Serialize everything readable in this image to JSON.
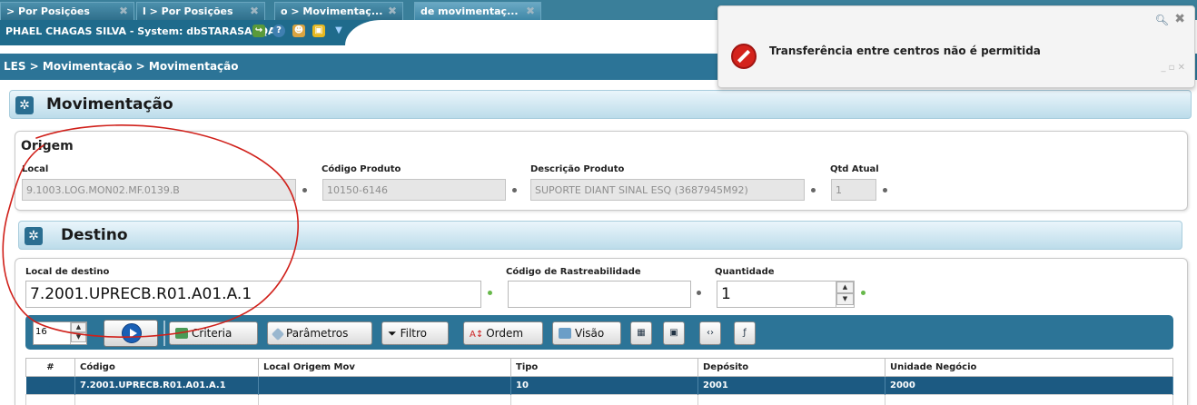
{
  "tabs": [
    {
      "label": "> Por Posições"
    },
    {
      "label": "l > Por Posições"
    },
    {
      "label": "o > Movimentaç..."
    },
    {
      "label": "de movimentaç..."
    }
  ],
  "titlebar": {
    "user_text": "PHAEL CHAGAS SILVA - System: dbSTARASAPQA"
  },
  "breadcrumb": "LES > Movimentação > Movimentação",
  "notification": {
    "message": "Transferência entre centros não é permitida"
  },
  "movimentacao": {
    "title": "Movimentação"
  },
  "origem": {
    "title": "Origem",
    "local_label": "Local",
    "local_value": "9.1003.LOG.MON02.MF.0139.B",
    "codigo_label": "Código Produto",
    "codigo_value": "10150-6146",
    "descricao_label": "Descrição Produto",
    "descricao_value": "SUPORTE DIANT SINAL ESQ (3687945M92)",
    "qtd_label": "Qtd Atual",
    "qtd_value": "1"
  },
  "destino": {
    "title": "Destino",
    "local_label": "Local de destino",
    "local_value": "7.2001.UPRECB.R01.A01.A.1",
    "rastreabilidade_label": "Código de Rastreabilidade",
    "rastreabilidade_value": "",
    "quantidade_label": "Quantidade",
    "quantidade_value": "1"
  },
  "toolbar": {
    "page_size": "16",
    "criteria": "Criteria",
    "parametros": "Parâmetros",
    "filtro": "Filtro",
    "ordem": "Ordem",
    "visao": "Visão"
  },
  "table": {
    "headers": [
      "#",
      "Código",
      "Local Origem Mov",
      "Tipo",
      "Depósito",
      "Unidade Negócio"
    ],
    "rows": [
      [
        "1",
        "7.2001.UPRECB.R01.A01.A.1",
        "",
        "10",
        "2001",
        "2000"
      ]
    ]
  },
  "colors": {
    "accent": "#2c7497",
    "row_selected": "#1c5a82",
    "annotation": "#d0201a"
  }
}
